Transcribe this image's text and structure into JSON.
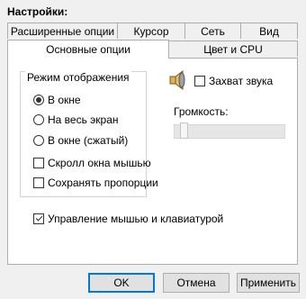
{
  "title": "Настройки:",
  "tabs_top": [
    {
      "label": "Расширенные опции"
    },
    {
      "label": "Курсор"
    },
    {
      "label": "Сеть"
    },
    {
      "label": "Вид"
    }
  ],
  "tabs_bottom": [
    {
      "label": "Основные опции",
      "active": true
    },
    {
      "label": "Цвет и CPU"
    }
  ],
  "display_group": {
    "legend": "Режим отображения",
    "radios": [
      {
        "label": "В окне",
        "selected": true
      },
      {
        "label": "На весь экран",
        "selected": false
      },
      {
        "label": "В окне (сжатый)",
        "selected": false
      }
    ],
    "checkboxes": [
      {
        "label": "Скролл окна мышью",
        "checked": false
      },
      {
        "label": "Сохранять пропорции",
        "checked": false
      }
    ]
  },
  "sound": {
    "icon": "speaker-icon",
    "capture_label": "Захват звука",
    "capture_checked": false,
    "volume_label": "Громкость:",
    "volume_level": 0.05
  },
  "mouse_keyboard": {
    "label": "Управление мышью и клавиатурой",
    "checked": true
  },
  "buttons": {
    "ok": "OK",
    "cancel": "Отмена",
    "apply": "Применить"
  }
}
